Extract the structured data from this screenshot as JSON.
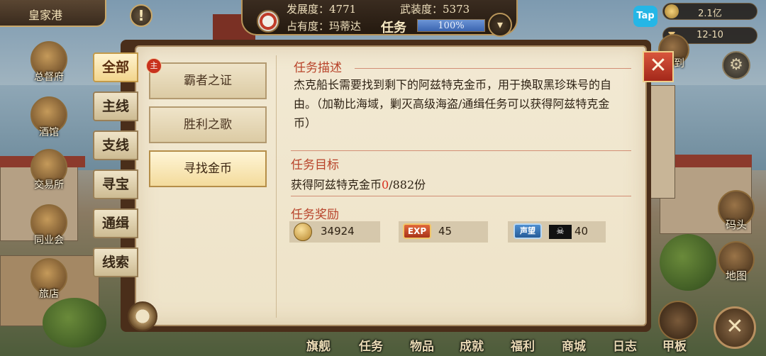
{
  "header": {
    "location": "皇家港",
    "alert_icon": "exclamation-icon",
    "development": "发展度：4771",
    "armament": "武装度：5373",
    "occupancy": "占有度：玛蒂达",
    "task_label": "任务",
    "task_progress_text": "100%",
    "task_progress": 1.0,
    "tap_label": "Tap",
    "gold": "2.1亿",
    "timer": "12-10"
  },
  "left_city": [
    {
      "label": "总督府",
      "icon": "governor-crown-icon"
    },
    {
      "label": "酒馆",
      "icon": "tavern-mug-icon"
    },
    {
      "label": "交易所",
      "icon": "exchange-scale-icon"
    },
    {
      "label": "同业会",
      "icon": "guild-shield-icon"
    },
    {
      "label": "旅店",
      "icon": "inn-bag-icon"
    }
  ],
  "right_side": {
    "signin_label": "签到",
    "dock_label": "码头",
    "map_label": "地图"
  },
  "categories": [
    "全部",
    "主线",
    "支线",
    "寻宝",
    "通缉",
    "线索"
  ],
  "active_category": "全部",
  "quests": [
    {
      "name": "霸者之证",
      "badge": "主"
    },
    {
      "name": "胜利之歌",
      "badge": ""
    },
    {
      "name": "寻找金币",
      "badge": ""
    }
  ],
  "active_quest": "寻找金币",
  "detail": {
    "desc_title": "任务描述",
    "desc_text": "杰克船长需要找到剩下的阿兹特克金币，用于换取黑珍珠号的自由。（加勒比海域，剿灭高级海盗/通缉任务可以获得阿兹特克金币）",
    "goal_title": "任务目标",
    "goal_prefix": "获得阿兹特克金币",
    "goal_current": "0",
    "goal_total": "/882份",
    "reward_title": "任务奖励",
    "rewards": {
      "coin": "34924",
      "exp_badge": "EXP",
      "exp": "45",
      "rep_badge": "声望",
      "rep": "40"
    }
  },
  "bottom_nav": [
    "旗舰",
    "任务",
    "物品",
    "成就",
    "福利",
    "商城",
    "日志",
    "甲板"
  ],
  "colors": {
    "accent_red": "#b8432a",
    "progress_blue": "#3a64b0",
    "parchment": "#f2e9d3"
  }
}
